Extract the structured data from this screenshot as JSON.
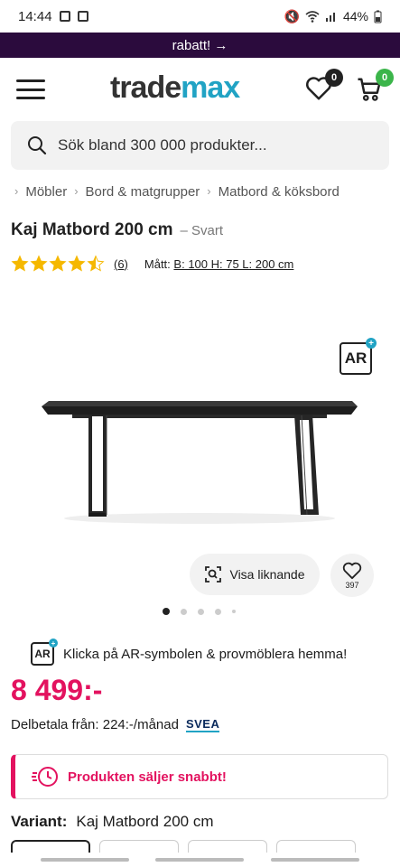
{
  "status_bar": {
    "time": "14:44",
    "battery": "44%"
  },
  "promo": {
    "text": "rabatt! →"
  },
  "header": {
    "logo_trade": "trade",
    "logo_max": "max",
    "wishlist_count": "0",
    "cart_count": "0",
    "colors": {
      "wishlist_badge": "#222222",
      "cart_badge": "#3bb54a"
    }
  },
  "search": {
    "placeholder": "Sök bland 300 000 produkter..."
  },
  "breadcrumbs": [
    "Möbler",
    "Bord & matgrupper",
    "Matbord & köksbord"
  ],
  "product": {
    "name": "Kaj Matbord 200 cm",
    "color_suffix": "– Svart",
    "rating": 4.5,
    "review_count": "(6)",
    "dims_label": "Mått:",
    "dims_value": "B: 100 H: 75 L: 200 cm",
    "ar_label": "AR",
    "similar_label": "Visa liknande",
    "favorite_count": "397",
    "gallery_index": 1,
    "gallery_total": 5,
    "ar_hint": "Klicka på AR-symbolen & provmöblera hemma!",
    "price": "8 499:-",
    "installment": "Delbetala från: 224:-/månad",
    "installment_provider": "SVEA",
    "alert": "Produkten säljer snabbt!",
    "variant_label": "Variant:",
    "variant_value": "Kaj Matbord 200 cm"
  },
  "colors": {
    "accent": "#e3125f",
    "promo_bg": "#2b0b3d",
    "brand_blue": "#21a3c4"
  }
}
